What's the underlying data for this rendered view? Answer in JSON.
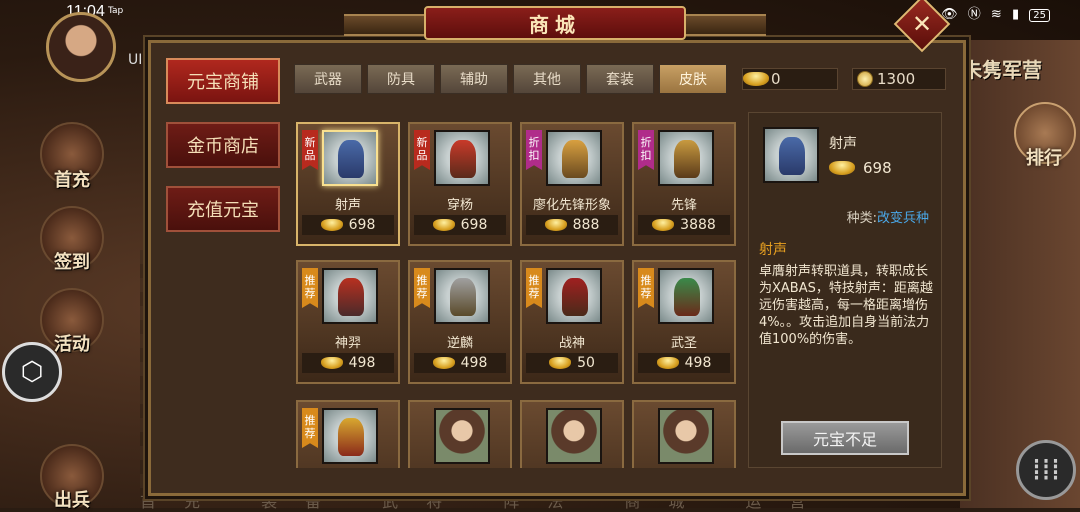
{
  "status": {
    "time": "11:04",
    "tap": "Tap",
    "battery": "25"
  },
  "avatar_tag": "UI",
  "side_menu": [
    "首充",
    "签到",
    "活动",
    "出兵"
  ],
  "right": {
    "zhu": "朱隽军营",
    "rank": "排行"
  },
  "bottom_faded": "首充  装备  武将  阵法  商城  运营",
  "title": "商城",
  "shop_tabs": [
    "元宝商铺",
    "金币商店",
    "充值元宝"
  ],
  "category_tabs": [
    "武器",
    "防具",
    "辅助",
    "其他",
    "套装",
    "皮肤"
  ],
  "currency": {
    "ingot": "0",
    "coin": "1300"
  },
  "items": [
    {
      "name": "射声",
      "price": "698",
      "badge": "新品",
      "badge_type": "new"
    },
    {
      "name": "穿杨",
      "price": "698",
      "badge": "新品",
      "badge_type": "new"
    },
    {
      "name": "廖化先锋形象",
      "price": "888",
      "badge": "折扣",
      "badge_type": "disc"
    },
    {
      "name": "先锋",
      "price": "3888",
      "badge": "折扣",
      "badge_type": "disc"
    },
    {
      "name": "神羿",
      "price": "498",
      "badge": "推荐",
      "badge_type": "rec"
    },
    {
      "name": "逆麟",
      "price": "498",
      "badge": "推荐",
      "badge_type": "rec"
    },
    {
      "name": "战神",
      "price": "50",
      "badge": "推荐",
      "badge_type": "rec"
    },
    {
      "name": "武圣",
      "price": "498",
      "badge": "推荐",
      "badge_type": "rec"
    },
    {
      "name": "",
      "price": "",
      "badge": "推荐",
      "badge_type": "rec"
    },
    {
      "name": "",
      "price": "",
      "badge": "",
      "badge_type": ""
    },
    {
      "name": "",
      "price": "",
      "badge": "",
      "badge_type": ""
    },
    {
      "name": "",
      "price": "",
      "badge": "",
      "badge_type": ""
    }
  ],
  "detail": {
    "name": "射声",
    "price": "698",
    "type_label": "种类:",
    "type_value": "改变兵种",
    "title": "射声",
    "description": "卓膺射声转职道具，转职成长为XABAS，特技射声：距离越远伤害越高，每一格距离增伤4%。。攻击追加自身当前法力值100%的伤害。",
    "buy_label": "元宝不足"
  },
  "colors": {
    "accent": "#b0281e",
    "gold": "#d8a020",
    "link": "#4aa8e8"
  }
}
